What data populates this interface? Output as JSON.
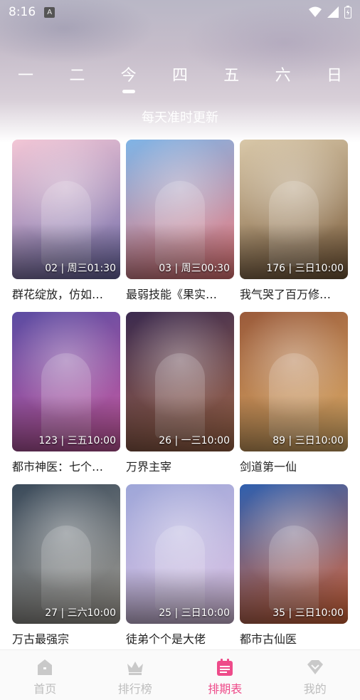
{
  "status": {
    "time": "8:16",
    "a_icon": "A"
  },
  "week": {
    "days": [
      "一",
      "二",
      "今",
      "四",
      "五",
      "六",
      "日"
    ],
    "active_index": 2
  },
  "subtitle": "每天准时更新",
  "cards": [
    {
      "title": "群花绽放，仿如…",
      "badge": "02 | 周三01:30",
      "colors": [
        "#f3c7d6",
        "#6e6aa8"
      ]
    },
    {
      "title": "最弱技能《果实…",
      "badge": "03 | 周三00:30",
      "colors": [
        "#7fb4e6",
        "#f27b7b"
      ]
    },
    {
      "title": "我气哭了百万修…",
      "badge": "176 | 三日10:00",
      "colors": [
        "#d9c8a9",
        "#7a5b3a"
      ]
    },
    {
      "title": "都市神医：七个…",
      "badge": "123 | 三五10:00",
      "colors": [
        "#5b4ca2",
        "#cc5aa2"
      ]
    },
    {
      "title": "万界主宰",
      "badge": "26 | 一三10:00",
      "colors": [
        "#3b2a4f",
        "#a66a4a"
      ]
    },
    {
      "title": "剑道第一仙",
      "badge": "89 | 三日10:00",
      "colors": [
        "#9a5a3a",
        "#e0b16a"
      ]
    },
    {
      "title": "万古最强宗",
      "badge": "27 | 三六10:00",
      "colors": [
        "#3a4a5a",
        "#a8a39a"
      ]
    },
    {
      "title": "徒弟个个是大佬",
      "badge": "25 | 三日10:00",
      "colors": [
        "#9ea6d8",
        "#e0c6e6"
      ]
    },
    {
      "title": "都市古仙医",
      "badge": "35 | 三日10:00",
      "colors": [
        "#2f5fae",
        "#e26a3a"
      ]
    }
  ],
  "tabs": [
    {
      "label": "首页",
      "icon": "home-icon"
    },
    {
      "label": "排行榜",
      "icon": "crown-icon"
    },
    {
      "label": "排期表",
      "icon": "calendar-icon"
    },
    {
      "label": "我的",
      "icon": "diamond-icon"
    }
  ],
  "colors": {
    "accent": "#ee4b8a",
    "inactive": "#bdbdbd"
  }
}
